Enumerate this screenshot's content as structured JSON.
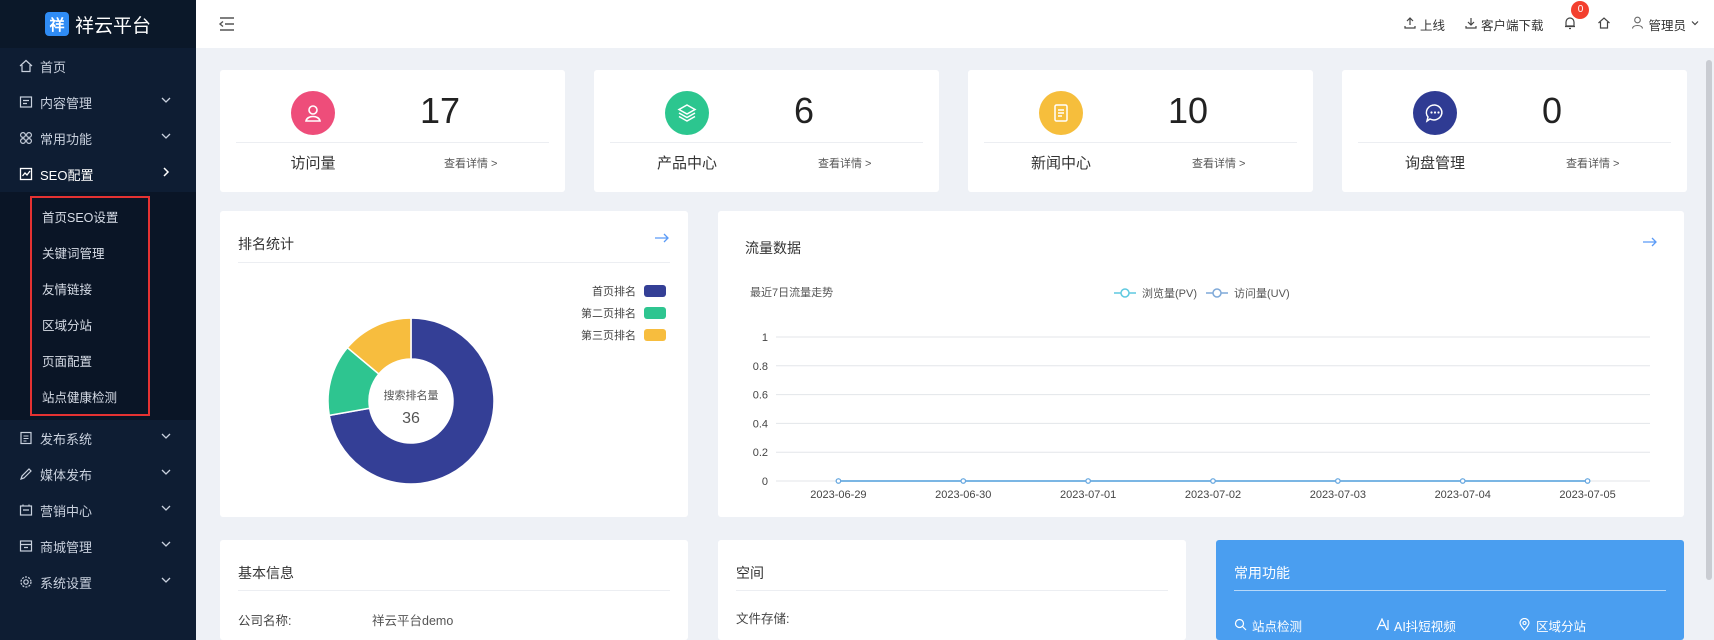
{
  "brand": {
    "name": "祥云平台",
    "icon_char": "祥"
  },
  "sidebar": {
    "items": [
      {
        "label": "首页",
        "icon": "home-icon"
      },
      {
        "label": "内容管理",
        "icon": "content-icon"
      },
      {
        "label": "常用功能",
        "icon": "grid-icon"
      },
      {
        "label": "SEO配置",
        "icon": "chart-icon"
      },
      {
        "label": "发布系统",
        "icon": "publish-icon"
      },
      {
        "label": "媒体发布",
        "icon": "pen-icon"
      },
      {
        "label": "营销中心",
        "icon": "marketing-icon"
      },
      {
        "label": "商城管理",
        "icon": "shop-icon"
      },
      {
        "label": "系统设置",
        "icon": "gear-icon"
      }
    ],
    "seo_sub": [
      "首页SEO设置",
      "关键词管理",
      "友情链接",
      "区域分站",
      "页面配置",
      "站点健康检测"
    ]
  },
  "header": {
    "online": "上线",
    "download": "客户端下载",
    "notify_count": "0",
    "user": "管理员"
  },
  "stats": [
    {
      "label": "访问量",
      "value": "17",
      "link": "查看详情 >",
      "color": "#ee4d7a",
      "icon": "user-icon"
    },
    {
      "label": "产品中心",
      "value": "6",
      "link": "查看详情 >",
      "color": "#2cc68f",
      "icon": "layers-icon"
    },
    {
      "label": "新闻中心",
      "value": "10",
      "link": "查看详情 >",
      "color": "#f6be3c",
      "icon": "document-icon"
    },
    {
      "label": "询盘管理",
      "value": "0",
      "link": "查看详情 >",
      "color": "#2f3b93",
      "icon": "chat-icon"
    }
  ],
  "ranking": {
    "title": "排名统计",
    "center_label": "搜索排名量",
    "center_value": "36",
    "legend": [
      {
        "name": "首页排名",
        "color": "#343f96"
      },
      {
        "name": "第二页排名",
        "color": "#2ec590"
      },
      {
        "name": "第三页排名",
        "color": "#f7bd3e"
      }
    ]
  },
  "traffic": {
    "title": "流量数据",
    "subtitle": "最近7日流量走势",
    "legend": [
      "浏览量(PV)",
      "访问量(UV)"
    ]
  },
  "basic": {
    "title": "基本信息",
    "company_label": "公司名称:",
    "company_value": "祥云平台demo"
  },
  "space": {
    "title": "空间",
    "storage_label": "文件存储:"
  },
  "common_funcs": {
    "title": "常用功能",
    "items": [
      "站点检测",
      "AI抖短视频",
      "区域分站"
    ]
  },
  "chart_data": [
    {
      "type": "pie",
      "title": "排名统计",
      "categories": [
        "首页排名",
        "第二页排名",
        "第三页排名"
      ],
      "values": [
        26,
        5,
        5
      ],
      "colors": [
        "#343f96",
        "#2ec590",
        "#f7bd3e"
      ],
      "total_label": "搜索排名量",
      "total": 36
    },
    {
      "type": "line",
      "title": "流量数据",
      "subtitle": "最近7日流量走势",
      "x": [
        "2023-06-29",
        "2023-06-30",
        "2023-07-01",
        "2023-07-02",
        "2023-07-03",
        "2023-07-04",
        "2023-07-05"
      ],
      "series": [
        {
          "name": "浏览量(PV)",
          "values": [
            0,
            0,
            0,
            0,
            0,
            0,
            0
          ]
        },
        {
          "name": "访问量(UV)",
          "values": [
            0,
            0,
            0,
            0,
            0,
            0,
            0
          ]
        }
      ],
      "ylim": [
        0,
        1
      ],
      "yticks": [
        "0",
        "0.2",
        "0.4",
        "0.6",
        "0.8",
        "1"
      ],
      "grid": true,
      "legend": "top-center"
    }
  ]
}
